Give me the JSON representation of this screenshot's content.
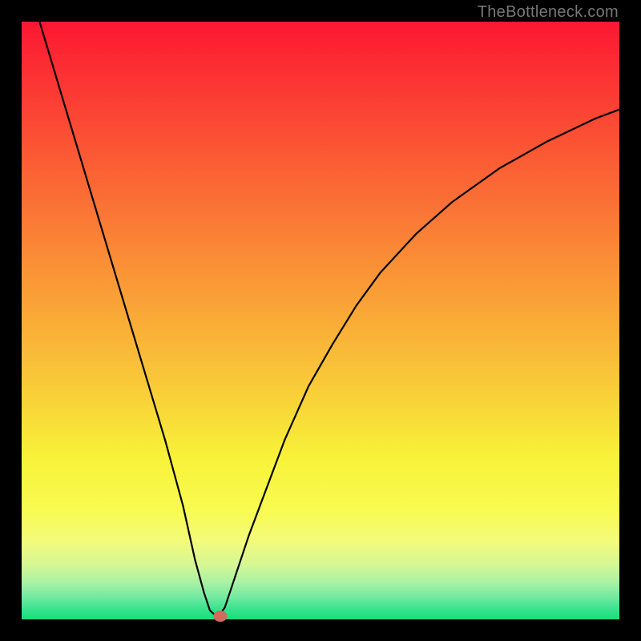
{
  "watermark": "TheBottleneck.com",
  "chart_data": {
    "type": "line",
    "title": "",
    "xlabel": "",
    "ylabel": "",
    "xlim": [
      0,
      100
    ],
    "ylim": [
      0,
      100
    ],
    "series": [
      {
        "name": "curve",
        "x": [
          3,
          6,
          9,
          12,
          15,
          18,
          21,
          24,
          27,
          29,
          30.5,
          31.5,
          32.5,
          33,
          34,
          36,
          38,
          41,
          44,
          48,
          52,
          56,
          60,
          66,
          72,
          80,
          88,
          96,
          100
        ],
        "y": [
          100,
          90,
          80,
          70,
          60,
          50,
          40,
          30,
          19,
          10,
          4.5,
          1.5,
          0.6,
          0.6,
          2,
          8,
          14,
          22,
          30,
          39,
          46,
          52.5,
          58,
          64.5,
          69.8,
          75.5,
          80,
          83.8,
          85.3
        ]
      }
    ],
    "marker": {
      "x": 33.2,
      "y": 0.6,
      "color": "#d46a5f"
    },
    "background_gradient": {
      "stops": [
        {
          "offset": 0,
          "color": "#fc1732"
        },
        {
          "offset": 20,
          "color": "#fb5234"
        },
        {
          "offset": 40,
          "color": "#fa8e36"
        },
        {
          "offset": 60,
          "color": "#f9c838"
        },
        {
          "offset": 73,
          "color": "#f8f239"
        },
        {
          "offset": 82,
          "color": "#f8fb52"
        },
        {
          "offset": 87,
          "color": "#f3fb7b"
        },
        {
          "offset": 91,
          "color": "#d4f795"
        },
        {
          "offset": 94,
          "color": "#a6f1a4"
        },
        {
          "offset": 96.5,
          "color": "#6ce9a0"
        },
        {
          "offset": 98.2,
          "color": "#3ae38f"
        },
        {
          "offset": 100,
          "color": "#16df79"
        }
      ]
    }
  }
}
